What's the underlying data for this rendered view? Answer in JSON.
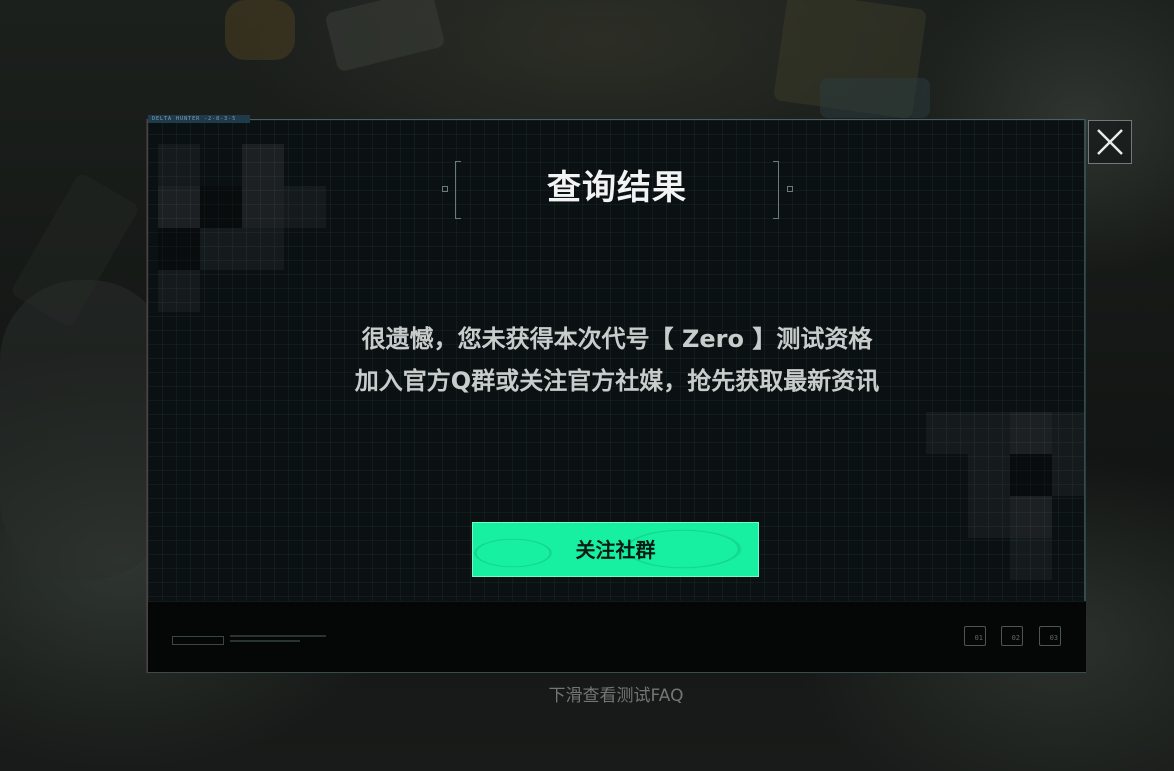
{
  "dialog": {
    "tag": "DELTA HUNTER -2-8-3-5",
    "title": "查询结果",
    "message_line1": "很遗憾，您未获得本次代号【 Zero 】测试资格",
    "message_line2": "加入官方Q群或关注官方社媒，抢先获取最新资讯",
    "button_label": "关注社群",
    "footer_boxes": [
      "01",
      "02",
      "03"
    ]
  },
  "hint": {
    "text": "下滑查看测试FAQ"
  },
  "colors": {
    "accent": "#17f0a0",
    "panel": "#0b1012",
    "title": "#f2f4f3",
    "message": "#c8cccb"
  },
  "icons": {
    "close": "close-icon"
  }
}
